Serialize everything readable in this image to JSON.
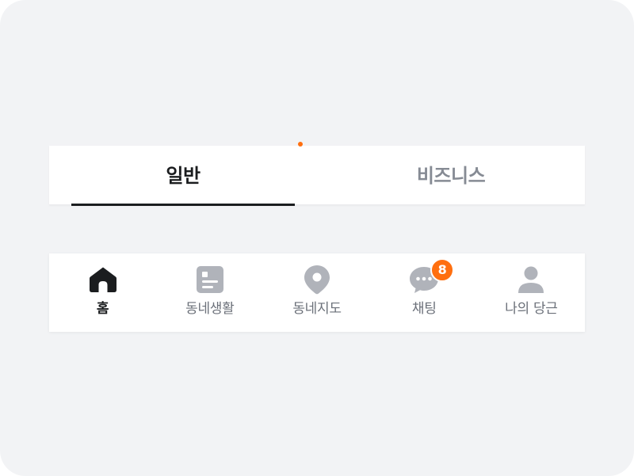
{
  "colors": {
    "accent": "#ff6f0f",
    "text_active": "#1b1d1f",
    "text_inactive": "#868b94",
    "icon_inactive": "#b0b3ba",
    "background": "#f2f3f5",
    "surface": "#ffffff"
  },
  "tabs": {
    "active_index": 0,
    "items": [
      {
        "label": "일반",
        "has_new_dot": true
      },
      {
        "label": "비즈니스",
        "has_new_dot": false
      }
    ]
  },
  "bottom_nav": {
    "active_index": 0,
    "items": [
      {
        "label": "홈",
        "icon": "home-icon"
      },
      {
        "label": "동네생활",
        "icon": "document-icon"
      },
      {
        "label": "동네지도",
        "icon": "map-pin-icon"
      },
      {
        "label": "채팅",
        "icon": "chat-bubble-icon",
        "badge": "8"
      },
      {
        "label": "나의 당근",
        "icon": "person-icon"
      }
    ]
  }
}
